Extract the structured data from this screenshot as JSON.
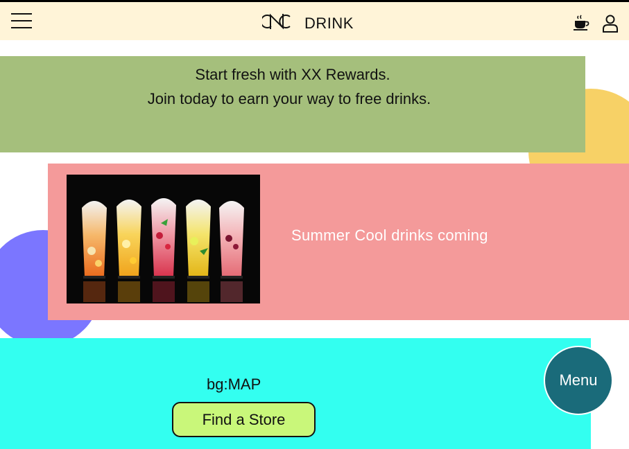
{
  "header": {
    "brand": "DRINK",
    "icons": {
      "menu": "hamburger-menu-icon",
      "logo": "cnc-logo-icon",
      "cup": "coffee-cup-icon",
      "user": "user-icon"
    }
  },
  "rewards": {
    "line1": "Start fresh with XX Rewards.",
    "line2": "Join today to earn your way to free drinks."
  },
  "promo": {
    "text": "Summer Cool drinks coming",
    "image_alt": "five glasses of iced fruit drinks"
  },
  "map_section": {
    "label": "bg:MAP",
    "button_label": "Find a Store"
  },
  "fab": {
    "label": "Menu"
  },
  "colors": {
    "header_bg": "#fff4d8",
    "rewards_bg": "#a5bf7c",
    "promo_bg": "#f49a9a",
    "map_bg": "#33fff0",
    "button_bg": "#c9f77a",
    "fab_bg": "#1a6b7a",
    "yellow_circle": "#f7d166",
    "purple_circle": "#7b76ff"
  }
}
